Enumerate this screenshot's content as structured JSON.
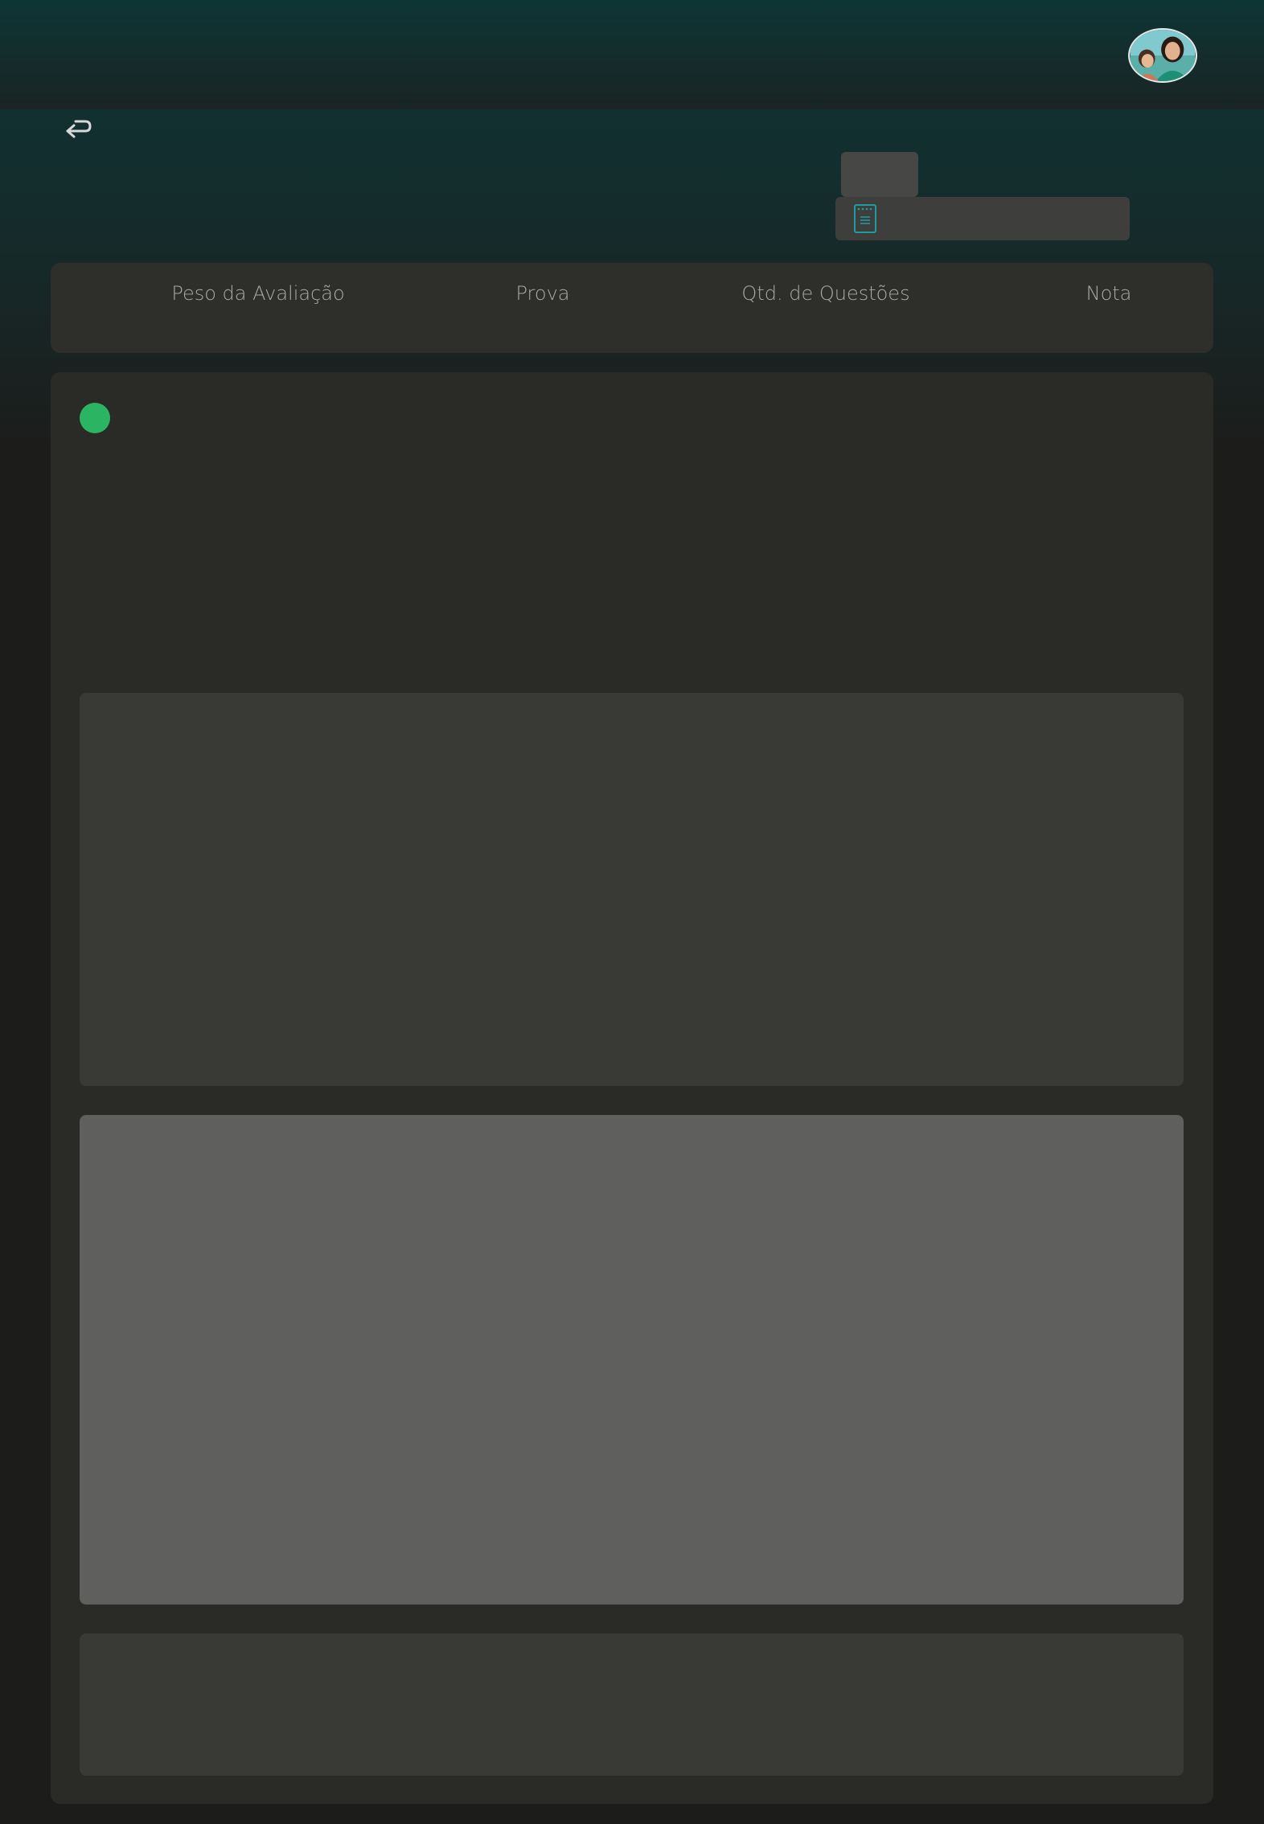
{
  "header": {
    "avatar_icon": "user-avatar-photo",
    "back_icon": "return-arrow-icon"
  },
  "filter": {
    "doc_icon": "document-icon",
    "accent_color": "#1a9ea1"
  },
  "table_header": {
    "columns": [
      "Peso da Avaliação",
      "Prova",
      "Qtd. de Questões",
      "Nota"
    ]
  },
  "content": {
    "status_color": "#2bb563"
  }
}
